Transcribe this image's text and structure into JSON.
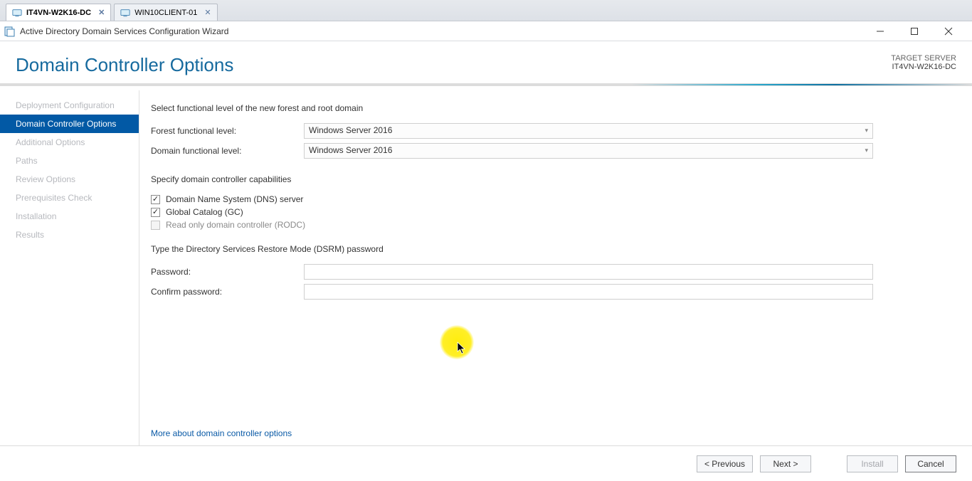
{
  "tabs": [
    {
      "label": "IT4VN-W2K16-DC",
      "active": true
    },
    {
      "label": "WIN10CLIENT-01",
      "active": false
    }
  ],
  "window_title": "Active Directory Domain Services Configuration Wizard",
  "page_title": "Domain Controller Options",
  "target": {
    "label": "TARGET SERVER",
    "value": "IT4VN-W2K16-DC"
  },
  "sidebar": {
    "items": [
      {
        "label": "Deployment Configuration",
        "active": false
      },
      {
        "label": "Domain Controller Options",
        "active": true
      },
      {
        "label": "Additional Options",
        "active": false
      },
      {
        "label": "Paths",
        "active": false
      },
      {
        "label": "Review Options",
        "active": false
      },
      {
        "label": "Prerequisites Check",
        "active": false
      },
      {
        "label": "Installation",
        "active": false
      },
      {
        "label": "Results",
        "active": false
      }
    ]
  },
  "content": {
    "functional_header": "Select functional level of the new forest and root domain",
    "forest_label": "Forest functional level:",
    "forest_value": "Windows Server 2016",
    "domain_label": "Domain functional level:",
    "domain_value": "Windows Server 2016",
    "capabilities_header": "Specify domain controller capabilities",
    "cb_dns_label": "Domain Name System (DNS) server",
    "cb_gc_label": "Global Catalog (GC)",
    "cb_rodc_label": "Read only domain controller (RODC)",
    "dsrm_header": "Type the Directory Services Restore Mode (DSRM) password",
    "password_label": "Password:",
    "confirm_label": "Confirm password:",
    "more_link": "More about domain controller options"
  },
  "footer": {
    "previous": "< Previous",
    "next": "Next >",
    "install": "Install",
    "cancel": "Cancel"
  }
}
